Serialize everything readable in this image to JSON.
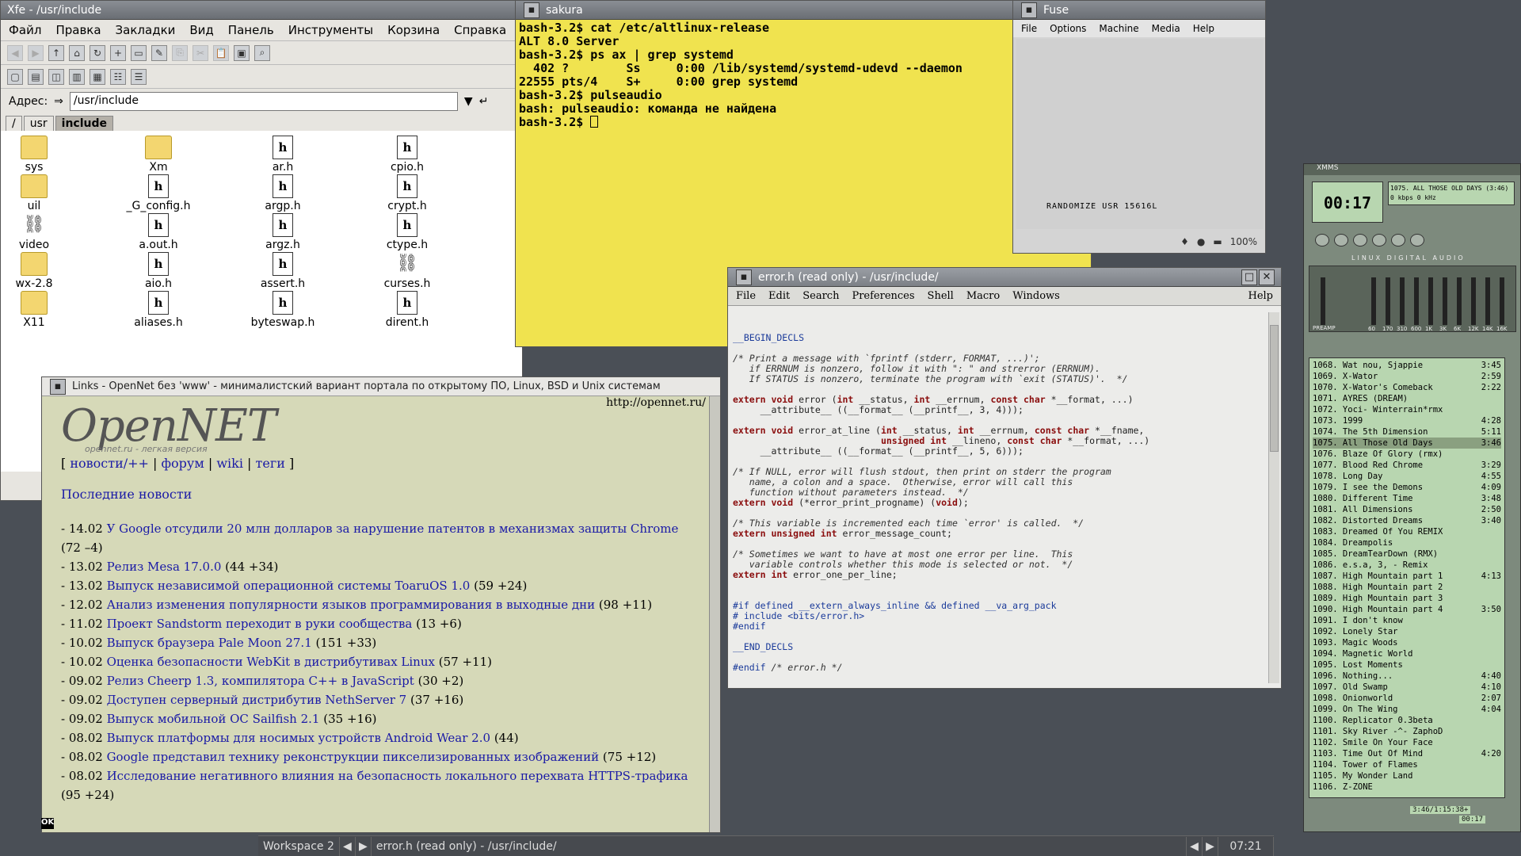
{
  "xfe": {
    "title": "Xfe - /usr/include",
    "menu": [
      "Файл",
      "Правка",
      "Закладки",
      "Вид",
      "Панель",
      "Инструменты",
      "Корзина",
      "Справка"
    ],
    "address_label": "Адрес:",
    "address_value": "/usr/include",
    "crumbs": [
      "/",
      "usr",
      "include"
    ],
    "files": [
      {
        "name": "sys",
        "type": "folder"
      },
      {
        "name": "Xm",
        "type": "folder"
      },
      {
        "name": "ar.h",
        "type": "h"
      },
      {
        "name": "cpio.h",
        "type": "h"
      },
      {
        "name": "uil",
        "type": "folder"
      },
      {
        "name": "_G_config.h",
        "type": "h"
      },
      {
        "name": "argp.h",
        "type": "h"
      },
      {
        "name": "crypt.h",
        "type": "h"
      },
      {
        "name": "video",
        "type": "link"
      },
      {
        "name": "a.out.h",
        "type": "h"
      },
      {
        "name": "argz.h",
        "type": "h"
      },
      {
        "name": "ctype.h",
        "type": "h"
      },
      {
        "name": "wx-2.8",
        "type": "folder"
      },
      {
        "name": "aio.h",
        "type": "h"
      },
      {
        "name": "assert.h",
        "type": "h"
      },
      {
        "name": "curses.h",
        "type": "link"
      },
      {
        "name": "X11",
        "type": "folder"
      },
      {
        "name": "aliases.h",
        "type": "h"
      },
      {
        "name": "byteswap.h",
        "type": "h"
      },
      {
        "name": "dirent.h",
        "type": "h"
      }
    ]
  },
  "sakura": {
    "title": "sakura",
    "lines": [
      "bash-3.2$ cat /etc/altlinux-release",
      "ALT 8.0 Server",
      "bash-3.2$ ps ax | grep systemd",
      "  402 ?        Ss     0:00 /lib/systemd/systemd-udevd --daemon",
      "22555 pts/4    S+     0:00 grep systemd",
      "bash-3.2$ pulseaudio",
      "bash: pulseaudio: команда не найдена"
    ],
    "prompt": "bash-3.2$ "
  },
  "fuse": {
    "title": "Fuse",
    "menu": [
      "File",
      "Options",
      "Machine",
      "Media",
      "Help"
    ],
    "screen_text": "RANDOMIZE USR 15616L",
    "zoom": "100%"
  },
  "nedit": {
    "title": "error.h (read only) - /usr/include/",
    "menu": [
      "File",
      "Edit",
      "Search",
      "Preferences",
      "Shell",
      "Macro",
      "Windows"
    ],
    "help": "Help"
  },
  "links": {
    "title": "Links - OpenNet без 'www' - минималистский вариант портала по открытому ПО, Linux, BSD и Unix системам",
    "url": "http://opennet.ru/",
    "logo": "OpenNET",
    "logo_sub": "opennet.ru - легкая версия",
    "nav": [
      "новости/++",
      "форум",
      "wiki",
      "теги"
    ],
    "section": "Последние новости",
    "news": [
      {
        "date": "14.02",
        "title": "У Google отсудили 20 млн долларов за нарушение патентов в механизмах защиты Chrome",
        "stats": "(72 –4)"
      },
      {
        "date": "13.02",
        "title": "Релиз Mesa 17.0.0",
        "stats": "(44 +34)"
      },
      {
        "date": "13.02",
        "title": "Выпуск независимой операционной системы ToaruOS 1.0",
        "stats": "(59 +24)"
      },
      {
        "date": "12.02",
        "title": "Анализ изменения популярности языков программирования в выходные дни",
        "stats": "(98 +11)"
      },
      {
        "date": "11.02",
        "title": "Проект Sandstorm переходит в руки сообщества",
        "stats": "(13 +6)"
      },
      {
        "date": "10.02",
        "title": "Выпуск браузера Pale Moon 27.1",
        "stats": "(151 +33)"
      },
      {
        "date": "10.02",
        "title": "Оценка безопасности WebKit в дистрибутивах Linux",
        "stats": "(57 +11)"
      },
      {
        "date": "09.02",
        "title": "Релиз Cheerp 1.3, компилятора C++ в JavaScript",
        "stats": "(30 +2)"
      },
      {
        "date": "09.02",
        "title": "Доступен серверный дистрибутив NethServer 7",
        "stats": "(37 +16)"
      },
      {
        "date": "09.02",
        "title": "Выпуск мобильной ОС Sailfish 2.1",
        "stats": "(35 +16)"
      },
      {
        "date": "08.02",
        "title": "Выпуск платформы для носимых устройств Android Wear 2.0",
        "stats": "(44)"
      },
      {
        "date": "08.02",
        "title": "Google представил технику реконструкции пикселизированных изображений",
        "stats": "(75 +12)"
      },
      {
        "date": "08.02",
        "title": "Исследование негативного влияния на безопасность локального перехвата HTTPS-трафика",
        "stats": "(95 +24)"
      }
    ],
    "ok": "OK"
  },
  "xmms": {
    "title": "XMMS",
    "time": "00:17",
    "song": "1075. ALL THOSE OLD DAYS (3:46)",
    "kbps": "0 kbps",
    "khz": "0 kHz",
    "eq_label": "LINUX DIGITAL AUDIO",
    "preamp": "PREAMP",
    "eq_freqs": [
      "60",
      "170",
      "310",
      "600",
      "1K",
      "3K",
      "6K",
      "12K",
      "14K",
      "16K"
    ],
    "playlist": [
      {
        "n": "1068. Wat nou, Sjappie",
        "t": "3:45"
      },
      {
        "n": "1069. X-Wator",
        "t": "2:59"
      },
      {
        "n": "1070. X-Wator's Comeback",
        "t": "2:22"
      },
      {
        "n": "1071. AYRES (DREAM)",
        "t": ""
      },
      {
        "n": "1072. Yoci- Winterrain*rmx",
        "t": ""
      },
      {
        "n": "1073. 1999",
        "t": "4:28"
      },
      {
        "n": "1074. The 5th Dimension",
        "t": "5:11"
      },
      {
        "n": "1075. All Those Old Days",
        "t": "3:46"
      },
      {
        "n": "1076. Blaze Of Glory (rmx)",
        "t": ""
      },
      {
        "n": "1077. Blood Red Chrome",
        "t": "3:29"
      },
      {
        "n": "1078. Long Day",
        "t": "4:55"
      },
      {
        "n": "1079. I see the Demons",
        "t": "4:09"
      },
      {
        "n": "1080. Different Time",
        "t": "3:48"
      },
      {
        "n": "1081. All Dimensions",
        "t": "2:50"
      },
      {
        "n": "1082. Distorted Dreams",
        "t": "3:40"
      },
      {
        "n": "1083. Dreamed Of You REMIX",
        "t": ""
      },
      {
        "n": "1084. Dreampolis",
        "t": ""
      },
      {
        "n": "1085. DreamTearDown (RMX)",
        "t": ""
      },
      {
        "n": "1086. e.s.a, 3, - Remix",
        "t": ""
      },
      {
        "n": "1087. High Mountain part 1",
        "t": "4:13"
      },
      {
        "n": "1088. High Mountain part 2",
        "t": ""
      },
      {
        "n": "1089. High Mountain part 3",
        "t": ""
      },
      {
        "n": "1090. High Mountain part 4",
        "t": "3:50"
      },
      {
        "n": "1091. I don't know",
        "t": ""
      },
      {
        "n": "1092. Lonely Star",
        "t": ""
      },
      {
        "n": "1093. Magic Woods",
        "t": ""
      },
      {
        "n": "1094. Magnetic World",
        "t": ""
      },
      {
        "n": "1095. Lost Moments",
        "t": ""
      },
      {
        "n": "1096. Nothing...",
        "t": "4:40"
      },
      {
        "n": "1097. Old Swamp",
        "t": "4:10"
      },
      {
        "n": "1098. Onionworld",
        "t": "2:07"
      },
      {
        "n": "1099. On The Wing",
        "t": "4:04"
      },
      {
        "n": "1100. Replicator 0.3beta",
        "t": ""
      },
      {
        "n": "1101. Sky River -^- ZaphoD",
        "t": ""
      },
      {
        "n": "1102. Smile On Your Face",
        "t": ""
      },
      {
        "n": "1103. Time Out Of Mind",
        "t": "4:20"
      },
      {
        "n": "1104. Tower of Flames",
        "t": ""
      },
      {
        "n": "1105. My Wonder Land",
        "t": ""
      },
      {
        "n": "1106. Z-ZONE",
        "t": ""
      }
    ],
    "footer_time": "3:46/1:15:38+",
    "footer_pos": "00:17"
  },
  "taskbar": {
    "workspace": "Workspace 2",
    "task": "error.h (read only) - /usr/include/",
    "clock": "07:21"
  }
}
